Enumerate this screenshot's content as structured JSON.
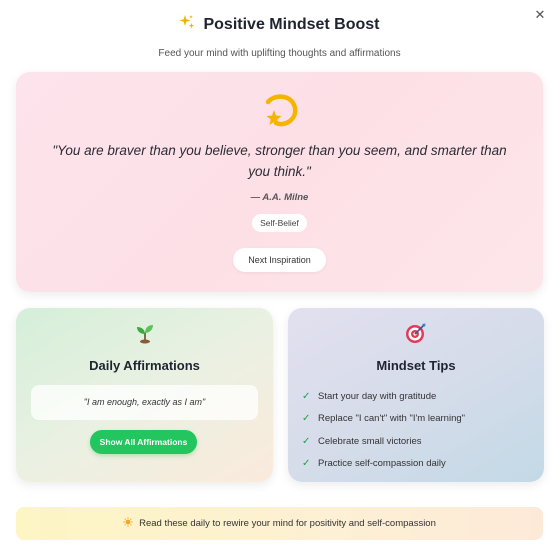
{
  "close": {
    "icon": "close-icon",
    "glyph": "✕"
  },
  "header": {
    "title": "Positive Mindset Boost",
    "title_icon": "sparkles-icon",
    "subtitle": "Feed your mind with uplifting thoughts and affirmations"
  },
  "quote": {
    "icon": "dizzy-star-icon",
    "text": "\"You are braver than you believe, stronger than you seem, and smarter than you think.\"",
    "author": "— A.A. Milne",
    "tag": "Self-Belief",
    "next_label": "Next Inspiration"
  },
  "affirmations": {
    "icon": "seedling-icon",
    "title": "Daily Affirmations",
    "current": "\"I am enough, exactly as I am\"",
    "show_all_label": "Show All Affirmations",
    "button_color": "#22c55e"
  },
  "tips": {
    "icon": "target-icon",
    "title": "Mindset Tips",
    "check_icon": "check-icon",
    "items": [
      "Start your day with gratitude",
      "Replace \"I can't\" with \"I'm learning\"",
      "Celebrate small victories",
      "Practice self-compassion daily"
    ]
  },
  "footer": {
    "icon": "sun-icon",
    "text": "Read these daily to rewire your mind for positivity and self-compassion"
  }
}
